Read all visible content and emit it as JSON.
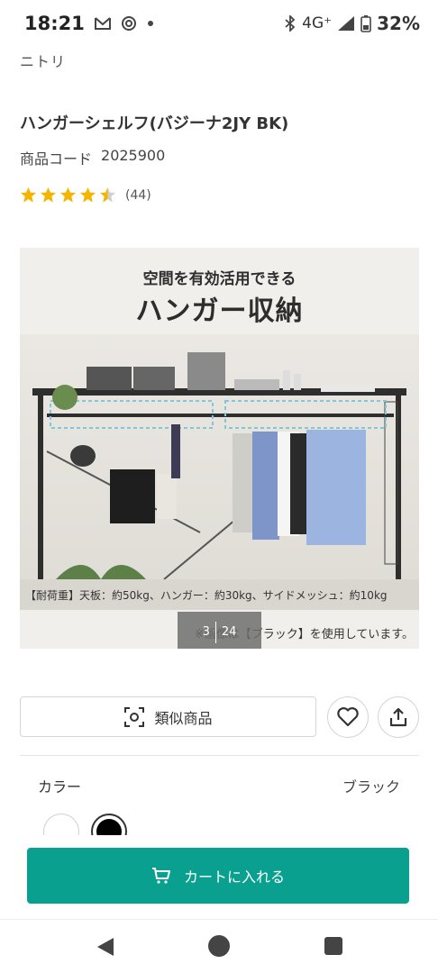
{
  "status_bar": {
    "time": "18:21",
    "network": "4G⁺",
    "battery": "32%",
    "left_icons": [
      "gmail-icon",
      "threads-icon",
      "dot-icon"
    ],
    "right_icons": [
      "bluetooth-icon",
      "signal-icon",
      "battery-icon"
    ]
  },
  "product": {
    "brand": "ニトリ",
    "title": "ハンガーシェルフ(バジーナ2JY BK)",
    "code_label": "商品コード",
    "code_value": "2025900",
    "rating_stars": 4.5,
    "rating_count": "(44)"
  },
  "gallery": {
    "headline_small": "空間を有効活用できる",
    "headline_large": "ハンガー収納",
    "caption": "【耐荷重】天板：約50kg、ハンガー：約30kg、サイドメッシュ：約10kg",
    "note": "※画像は【ブラック】を使用しています。",
    "current_index": "3",
    "total": "24"
  },
  "actions": {
    "similar_label": "類似商品",
    "favorite_icon": "heart-icon",
    "share_icon": "share-icon"
  },
  "color": {
    "label": "カラー",
    "selected": "ブラック",
    "swatches": [
      "#ffffff",
      "#000000"
    ]
  },
  "cart": {
    "label": "カートに入れる",
    "accent": "#0aa08f"
  },
  "colors": {
    "star": "#f4b400",
    "star_empty": "#cfcfcf"
  }
}
